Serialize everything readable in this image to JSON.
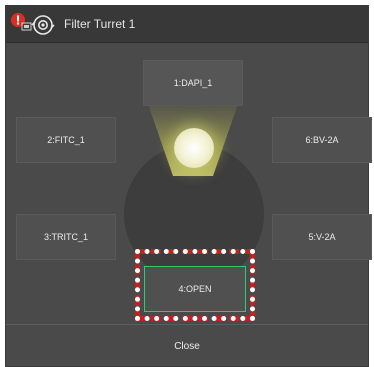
{
  "window": {
    "title": "Filter Turret 1",
    "app_icon": "app-badge-icon",
    "logo_icon": "turret-logo-icon"
  },
  "turret": {
    "positions": [
      {
        "id": 1,
        "label": "1:DAPI_1"
      },
      {
        "id": 2,
        "label": "2:FITC_1"
      },
      {
        "id": 3,
        "label": "3:TRITC_1"
      },
      {
        "id": 4,
        "label": "4:OPEN",
        "selected": true
      },
      {
        "id": 5,
        "label": "5:V-2A"
      },
      {
        "id": 6,
        "label": "6:BV-2A"
      }
    ],
    "active_position": 1
  },
  "footer": {
    "close_label": "Close"
  },
  "colors": {
    "background": "#4a4a4a",
    "titlebar": "#383838",
    "selection_outline": "#2ecc71",
    "highlight_frame": "#c42020",
    "lamp_glow": "#f4f3d7"
  }
}
